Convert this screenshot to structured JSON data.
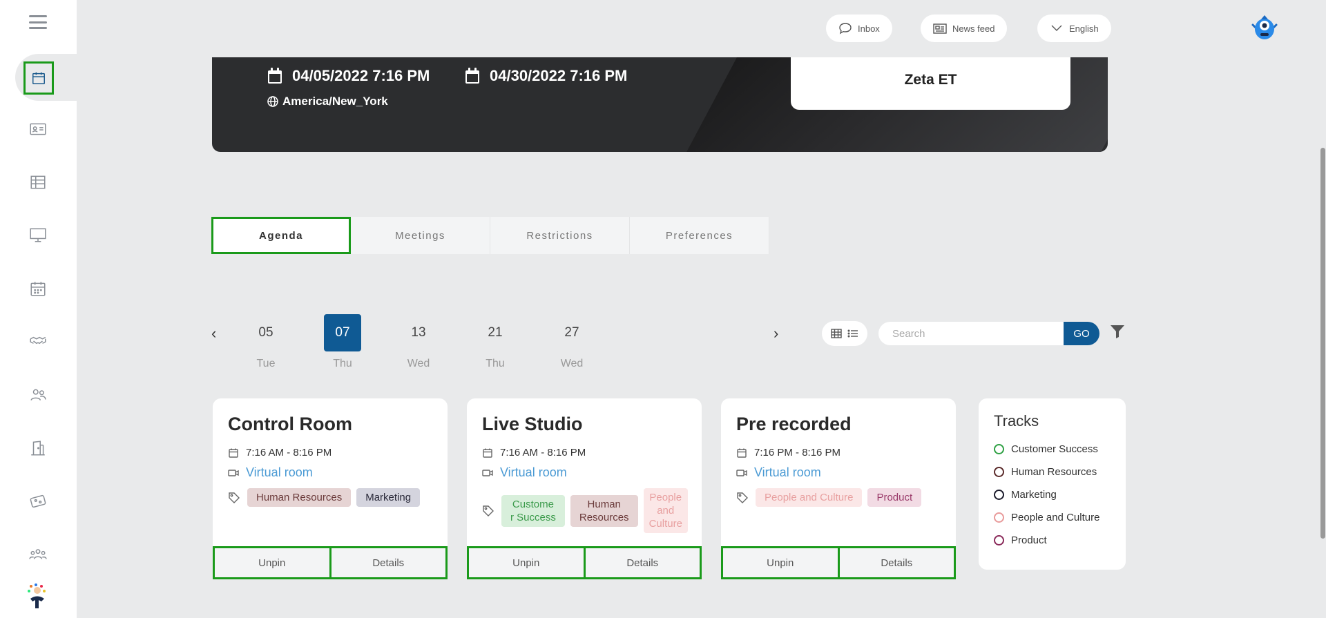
{
  "topbar": {
    "inbox_label": "Inbox",
    "newsfeed_label": "News feed",
    "language_label": "English"
  },
  "hero": {
    "start_date": "04/05/2022 7:16 PM",
    "end_date": "04/30/2022 7:16 PM",
    "timezone": "America/New_York",
    "event_name": "Zeta ET"
  },
  "tabs": [
    {
      "label": "Agenda",
      "active": true
    },
    {
      "label": "Meetings"
    },
    {
      "label": "Restrictions"
    },
    {
      "label": "Preferences"
    }
  ],
  "date_picker": {
    "days": [
      {
        "num": "05",
        "dow": "Tue"
      },
      {
        "num": "07",
        "dow": "Thu",
        "active": true
      },
      {
        "num": "13",
        "dow": "Wed"
      },
      {
        "num": "21",
        "dow": "Thu"
      },
      {
        "num": "27",
        "dow": "Wed"
      }
    ],
    "prev_icon": "chevron-left-icon",
    "next_icon": "chevron-right-icon"
  },
  "search": {
    "placeholder": "Search",
    "go_label": "GO"
  },
  "sessions": [
    {
      "title": "Control Room",
      "time": "7:16 AM - 8:16 PM",
      "location": "Virtual room",
      "tags": [
        "Human Resources",
        "Marketing"
      ],
      "unpin_label": "Unpin",
      "details_label": "Details"
    },
    {
      "title": "Live Studio",
      "time": "7:16 AM - 8:16 PM",
      "location": "Virtual room",
      "tags": [
        "Custome\nr Success",
        "Human\nResources",
        "People\nand\nCulture"
      ],
      "unpin_label": "Unpin",
      "details_label": "Details"
    },
    {
      "title": "Pre recorded",
      "time": "7:16 PM - 8:16 PM",
      "location": "Virtual room",
      "tags": [
        "People and Culture",
        "Product"
      ],
      "unpin_label": "Unpin",
      "details_label": "Details"
    }
  ],
  "tracks": {
    "title": "Tracks",
    "items": [
      {
        "label": "Customer Success",
        "color": "#2ea043"
      },
      {
        "label": "Human Resources",
        "color": "#5a2a2a"
      },
      {
        "label": "Marketing",
        "color": "#1a1a2a"
      },
      {
        "label": "People and Culture",
        "color": "#e89a9a"
      },
      {
        "label": "Product",
        "color": "#8a2a5a"
      }
    ]
  },
  "colors": {
    "accent": "#0f5a94",
    "highlight": "#1a9a1a",
    "link": "#4a9ad4"
  }
}
